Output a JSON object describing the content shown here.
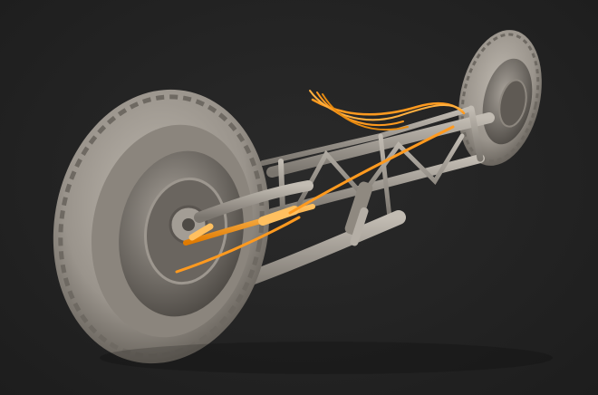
{
  "scene": {
    "subject": "axle-assembly-render",
    "colors": {
      "background": "#232323",
      "clay": "#9a948c",
      "clay_light": "#bdb7ae",
      "clay_dark": "#5f5a54",
      "tire_groove": "#6e6962",
      "highlight_orange": "#ff9a1f",
      "highlight_orange_light": "#ffc060"
    }
  }
}
